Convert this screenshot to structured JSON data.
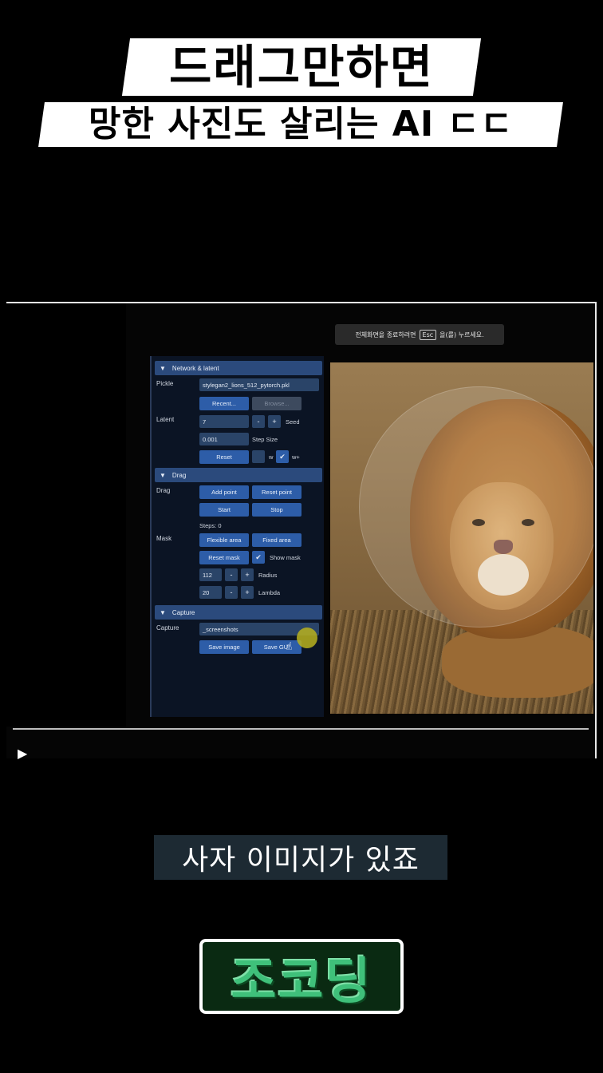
{
  "title": {
    "line1": "드래그만하면",
    "line2": "망한 사진도 살리는 AI ㄷㄷ"
  },
  "video": {
    "esc_toast": {
      "before": "전체화면을 종료하려면",
      "key": "Esc",
      "after": "을(를) 누르세요."
    },
    "gui": {
      "network_section": "Network & latent",
      "pickle_label": "Pickle",
      "pickle_value": "stylegan2_lions_512_pytorch.pkl",
      "recent_button": "Recent...",
      "browse_button": "Browse...",
      "latent_label": "Latent",
      "seed_value": "7",
      "minus": "-",
      "plus": "+",
      "seed_label": "Seed",
      "step_value": "0.001",
      "step_label": "Step Size",
      "reset_button": "Reset",
      "w_label": "w",
      "wplus_label": "w+",
      "drag_section": "Drag",
      "drag_label": "Drag",
      "add_point_button": "Add point",
      "reset_point_button": "Reset point",
      "start_button": "Start",
      "stop_button": "Stop",
      "steps_text": "Steps: 0",
      "mask_label": "Mask",
      "flexible_area_button": "Flexible area",
      "fixed_area_button": "Fixed area",
      "reset_mask_button": "Reset mask",
      "show_mask_label": "Show mask",
      "radius_value": "112",
      "radius_label": "Radius",
      "lambda_value": "20",
      "lambda_label": "Lambda",
      "capture_section": "Capture",
      "capture_label": "Capture",
      "capture_path": "_screenshots",
      "save_image_button": "Save image",
      "save_gui_button": "Save GUI"
    },
    "play_icon": "play-icon"
  },
  "subtitle": "사자 이미지가 있죠",
  "logo": "조코딩"
}
